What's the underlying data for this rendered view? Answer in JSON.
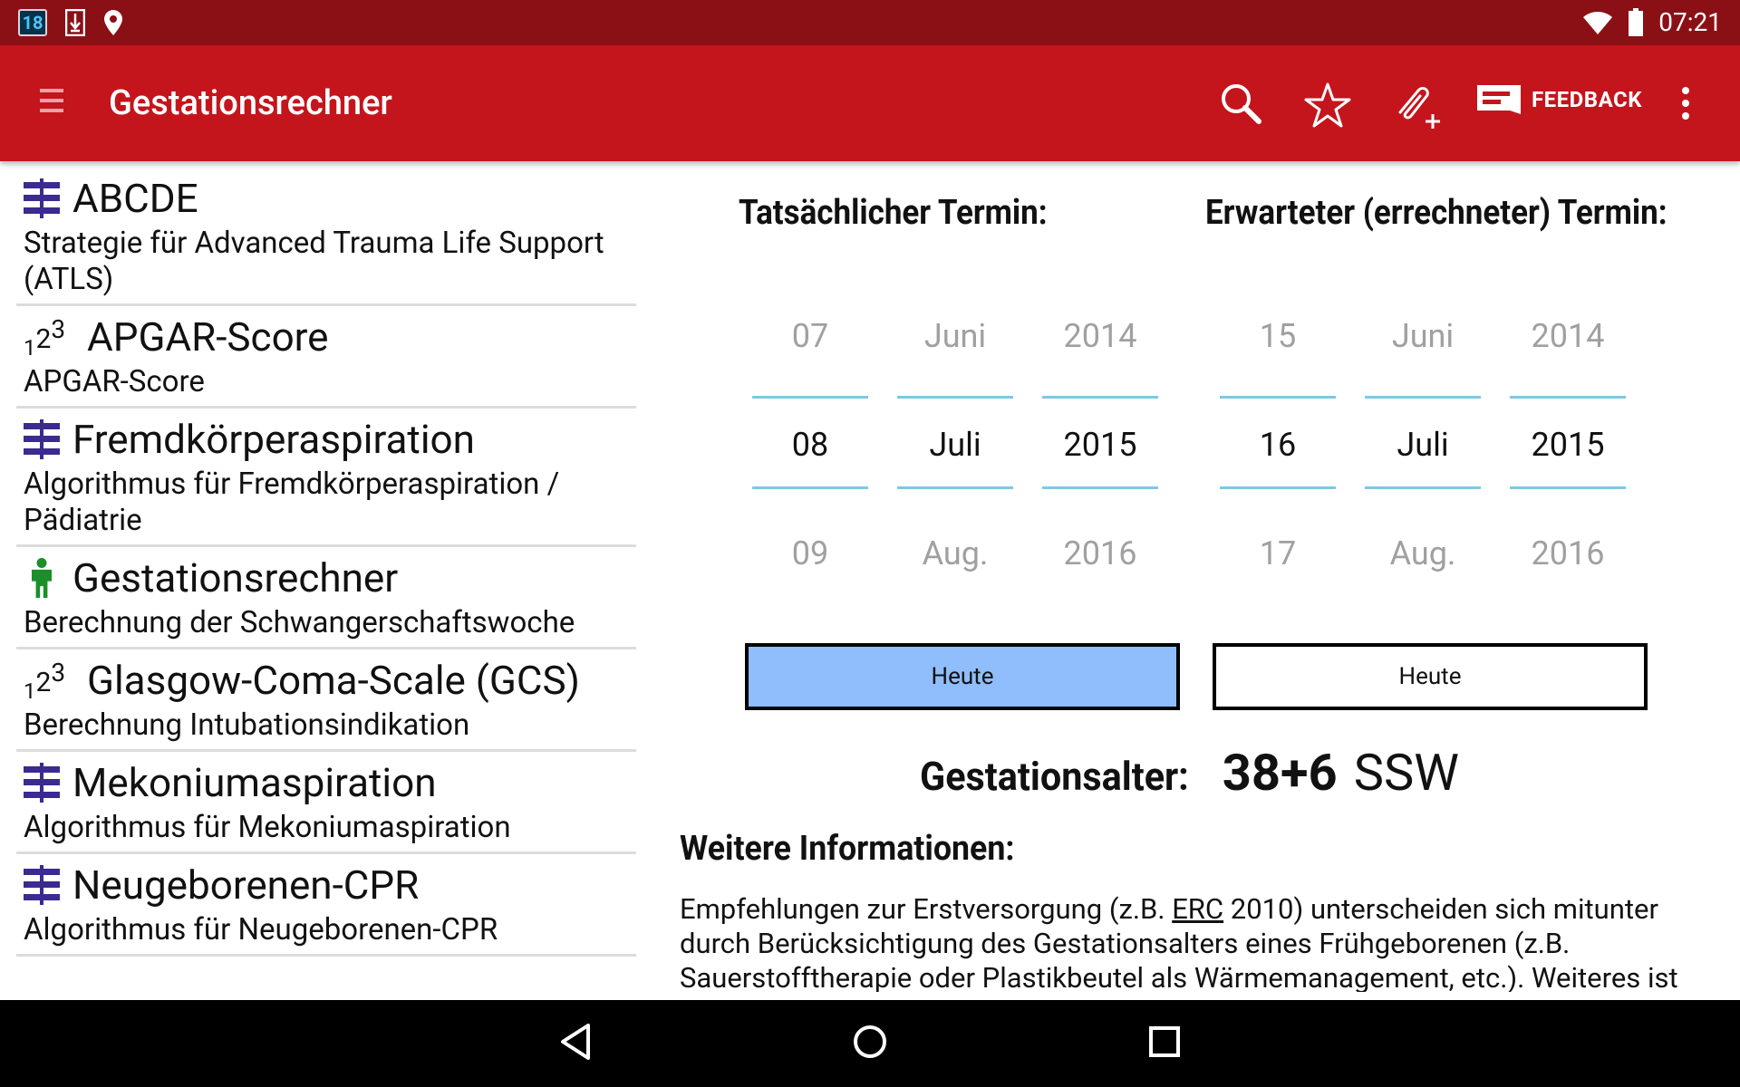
{
  "status_bar": {
    "notification_count": "18",
    "time": "07:21"
  },
  "app_bar": {
    "title": "Gestationsrechner",
    "feedback_label": "FEEDBACK"
  },
  "list": [
    {
      "icon": "algorithm-icon",
      "title": "ABCDE",
      "subtitle": "Strategie für Advanced Trauma Life Support (ATLS)"
    },
    {
      "icon": "score-icon",
      "title": "APGAR-Score",
      "subtitle": "APGAR-Score"
    },
    {
      "icon": "algorithm-icon",
      "title": "Fremdkörperaspiration",
      "subtitle": "Algorithmus für Fremdkörperaspiration / Pädiatrie"
    },
    {
      "icon": "person-icon",
      "title": "Gestationsrechner",
      "subtitle": "Berechnung der Schwangerschaftswoche"
    },
    {
      "icon": "score-icon",
      "title": "Glasgow-Coma-Scale (GCS)",
      "subtitle": "Berechnung Intubationsindikation"
    },
    {
      "icon": "algorithm-icon",
      "title": "Mekoniumaspiration",
      "subtitle": "Algorithmus für Mekoniumaspiration"
    },
    {
      "icon": "algorithm-icon",
      "title": "Neugeborenen-CPR",
      "subtitle": "Algorithmus für Neugeborenen-CPR"
    }
  ],
  "score_icon_text": {
    "sub": "1",
    "base": "2",
    "sup": "3"
  },
  "actual": {
    "title": "Tatsächlicher Termin:",
    "day": {
      "prev": "07",
      "value": "08",
      "next": "09"
    },
    "month": {
      "prev": "Juni",
      "value": "Juli",
      "next": "Aug."
    },
    "year": {
      "prev": "2014",
      "value": "2015",
      "next": "2016"
    },
    "today_label": "Heute"
  },
  "expected": {
    "title": "Erwarteter (errechneter) Termin:",
    "day": {
      "prev": "15",
      "value": "16",
      "next": "17"
    },
    "month": {
      "prev": "Juni",
      "value": "Juli",
      "next": "Aug."
    },
    "year": {
      "prev": "2014",
      "value": "2015",
      "next": "2016"
    },
    "today_label": "Heute"
  },
  "gestation": {
    "label": "Gestationsalter:",
    "value": "38+6",
    "unit": "SSW"
  },
  "info": {
    "title": "Weitere Informationen:",
    "text_before": "Empfehlungen zur Erstversorgung (z.B. ",
    "link": "ERC",
    "text_after": " 2010) unterscheiden sich mitunter durch Berücksichtigung des Gestationsalters eines Frühgeborenen (z.B. Sauerstofftherapie oder Plastikbeutel als Wärmemanagement, etc.). Weiteres ist"
  },
  "colors": {
    "status_bar": "#8b1016",
    "app_bar": "#c4151c",
    "today_active": "#90bdfc",
    "picker_line": "#7ec8e3",
    "algorithm_icon": "#3b2a8f",
    "person_icon": "#1b8f2a"
  }
}
